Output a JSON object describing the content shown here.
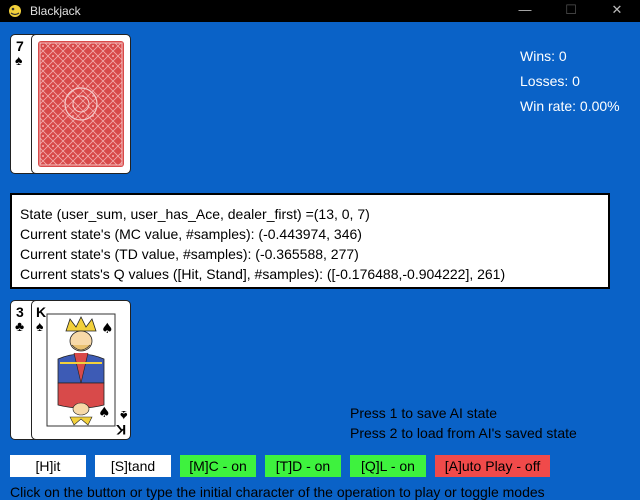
{
  "window": {
    "title": "Blackjack",
    "controls": {
      "minimize": "—",
      "maximize": "☐",
      "close": "✕"
    }
  },
  "stats": {
    "wins": "Wins: 0",
    "losses": "Losses: 0",
    "win_rate": "Win rate: 0.00%"
  },
  "dealer": {
    "cards": [
      {
        "rank": "7",
        "suit": "♠",
        "face_up": true
      },
      {
        "face_up": false
      }
    ]
  },
  "state_info": {
    "lines": [
      "State (user_sum, user_has_Ace, dealer_first) =(13, 0, 7)",
      "Current state's (MC value, #samples): (-0.443974, 346)",
      "Current state's (TD value, #samples): (-0.365588, 277)",
      "Current stats's Q values ([Hit, Stand], #samples): ([-0.176488,-0.904222], 261)"
    ]
  },
  "player": {
    "cards": [
      {
        "rank": "3",
        "suit": "♣"
      },
      {
        "rank": "K",
        "suit": "♠"
      }
    ]
  },
  "messages": {
    "save": "Press 1 to save AI state",
    "load": "Press 2 to load from AI's saved state"
  },
  "buttons": {
    "hit": "[H]it",
    "stand": "[S]tand",
    "mc": "[M]C - on",
    "td": "[T]D - on",
    "ql": "[Q]L - on",
    "auto": "[A]uto Play - off"
  },
  "footer": "Click on the button or type the initial character of the operation to play or toggle modes",
  "colors": {
    "background": "#0a62c7",
    "button_white": "#ffffff",
    "button_on": "#3ef23e",
    "button_off": "#f04a4a",
    "card_back": "#d84a4a"
  }
}
